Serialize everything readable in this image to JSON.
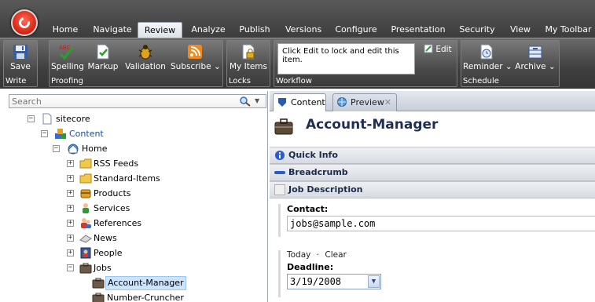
{
  "ribbon": {
    "tabs": [
      "Home",
      "Navigate",
      "Review",
      "Analyze",
      "Publish",
      "Versions",
      "Configure",
      "Presentation",
      "Security",
      "View",
      "My Toolbar"
    ],
    "active_tab": "Review",
    "groups": {
      "write": {
        "label": "Write",
        "buttons": {
          "save": "Save"
        }
      },
      "proofing": {
        "label": "Proofing",
        "buttons": {
          "spelling": "Spelling",
          "markup": "Markup",
          "validation": "Validation",
          "subscribe": "Subscribe"
        }
      },
      "locks": {
        "label": "Locks",
        "buttons": {
          "my_items": "My Items"
        }
      },
      "workflow": {
        "label": "Workflow",
        "message": "Click Edit to lock and edit this item.",
        "edit": "Edit"
      },
      "schedule": {
        "label": "Schedule",
        "buttons": {
          "reminder": "Reminder",
          "archive": "Archive"
        }
      }
    }
  },
  "search": {
    "placeholder": "Search"
  },
  "tree": {
    "sitecore": "sitecore",
    "content": "Content",
    "home": "Home",
    "rss": "RSS Feeds",
    "standard": "Standard-Items",
    "products": "Products",
    "services": "Services",
    "references": "References",
    "news": "News",
    "people": "People",
    "jobs": "Jobs",
    "account_manager": "Account-Manager",
    "number_cruncher": "Number-Cruncher"
  },
  "editor": {
    "tabs": {
      "content": "Content",
      "preview": "Preview"
    },
    "title": "Account-Manager",
    "sections": {
      "quick_info": "Quick Info",
      "breadcrumb": "Breadcrumb",
      "job_description": "Job Description"
    },
    "contact": {
      "label": "Contact:",
      "value": "jobs@sample.com"
    },
    "deadline": {
      "today": "Today",
      "sep": "·",
      "clear": "Clear",
      "label": "Deadline:",
      "value": "3/19/2008"
    }
  }
}
